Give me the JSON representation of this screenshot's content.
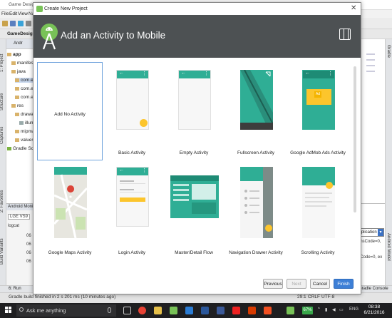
{
  "ide": {
    "title": "Game Design Br",
    "menu": [
      "File",
      "Edit",
      "View",
      "Na"
    ],
    "crumb": "GameDesignB",
    "project_tab": "Andr",
    "tree": [
      "app",
      "manifests",
      "java",
      "com.exa",
      "com.exa",
      "com.exa",
      "res",
      "drawable",
      "illum",
      "mipmap",
      "values",
      "Gradle Scripts"
    ],
    "left_tabs": [
      "1: Project",
      "Structure",
      "Captures",
      "2: Favorites",
      "Build Variants"
    ],
    "right_tabs": [
      "Gradle",
      "Android Model"
    ],
    "android_monitor": "Android Monitor",
    "device": "LGE VS9",
    "logcat": "logcat",
    "log_lines": [
      "06",
      "06",
      "06",
      "06"
    ],
    "log_right": [
      "ansCode=0,",
      "eCode=0, ex"
    ],
    "dropdown": "application",
    "bottom_tabs": [
      "6: Run",
      "Gradle Console"
    ],
    "status_text": "Gradle build finished in 2 s 201 ms (10 minutes ago)",
    "status_right": [
      "29:1",
      "CRLF",
      "UTF-8"
    ]
  },
  "dialog": {
    "window_title": "Create New Project",
    "heading": "Add an Activity to Mobile",
    "activities": [
      {
        "label": "Add No Activity"
      },
      {
        "label": "Basic Activity"
      },
      {
        "label": "Empty Activity"
      },
      {
        "label": "Fullscreen Activity"
      },
      {
        "label": "Google AdMob Ads Activity"
      },
      {
        "label": "Google Maps Activity"
      },
      {
        "label": "Login Activity"
      },
      {
        "label": "Master/Detail Flow"
      },
      {
        "label": "Navigation Drawer Activity"
      },
      {
        "label": "Scrolling Activity"
      }
    ],
    "ad_text": "Ad",
    "buttons": {
      "previous": "Previous",
      "next": "Next",
      "cancel": "Cancel",
      "finish": "Finish"
    }
  },
  "taskbar": {
    "search_placeholder": "Ask me anything",
    "battery": "67%",
    "language": "ENG",
    "time": "08:38",
    "date": "6/21/2016"
  },
  "colors": {
    "accent": "#3d7fd6",
    "teal": "#2fae95",
    "header": "#4d5153",
    "fab": "#fcc52c"
  }
}
